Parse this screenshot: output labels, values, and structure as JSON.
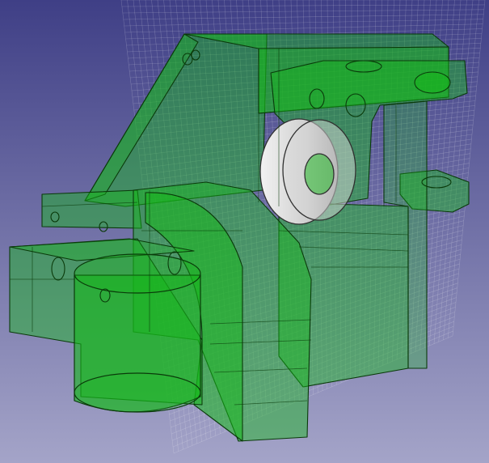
{
  "viewport": {
    "background_top": "#3f3f86",
    "background_bottom": "#a4a4c8"
  },
  "grid": {
    "line_color": "#ffffff"
  },
  "part": {
    "fill": "#16b81a",
    "edge": "#0a3a0a"
  },
  "wheel": {
    "fill": "#d8d8d8",
    "edge": "#303030"
  }
}
